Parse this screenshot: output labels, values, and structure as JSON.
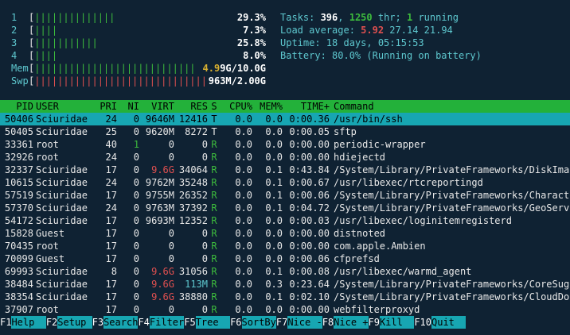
{
  "meters": {
    "cpu": [
      {
        "label": "1",
        "bars": "||||||||||||||",
        "value": "29.3%"
      },
      {
        "label": "2",
        "bars": "||||",
        "value": "7.3%"
      },
      {
        "label": "3",
        "bars": "|||||||||||",
        "value": "25.8%"
      },
      {
        "label": "4",
        "bars": "||||",
        "value": "8.0%"
      }
    ],
    "mem": {
      "label": "Mem",
      "bars": "||||||||||||||||||||||||||||",
      "value_num": "4.9",
      "value_rest": "9G/10.0G"
    },
    "swp": {
      "label": "Swp",
      "bars": "||||||||||||||||||||||||||||||",
      "value": "963M/2.00G"
    }
  },
  "info": {
    "tasks_label": "Tasks: ",
    "tasks": "396",
    "thr": "1250",
    "thr_label": " thr; ",
    "running": "1",
    "running_label": " running",
    "load_label": "Load average: ",
    "load1": "5.92",
    "load5": "27.14",
    "load15": "21.94",
    "uptime_label": "Uptime: ",
    "uptime": "18 days, 05:15:53",
    "battery_label": "Battery: ",
    "battery": "80.0% (Running on battery)"
  },
  "columns": {
    "pid": "PID",
    "user": "USER",
    "pri": "PRI",
    "ni": "NI",
    "virt": "VIRT",
    "res": "RES",
    "s": "S",
    "cpu": "CPU%",
    "mem": "MEM%",
    "time": "TIME+",
    "cmd": "Command"
  },
  "processes": [
    {
      "pid": "50406",
      "user": "Sciuridae",
      "pri": "24",
      "ni": "0",
      "virt": "9646M",
      "res": "12416",
      "s": "T",
      "cpu": "0.0",
      "mem": "0.0",
      "time": "0:00.36",
      "cmd": "/usr/bin/ssh"
    },
    {
      "pid": "50405",
      "user": "Sciuridae",
      "pri": "25",
      "ni": "0",
      "virt": "9620M",
      "res": "8272",
      "s": "T",
      "cpu": "0.0",
      "mem": "0.0",
      "time": "0:00.05",
      "cmd": "sftp"
    },
    {
      "pid": "33361",
      "user": "root",
      "pri": "40",
      "ni": "1",
      "virt": "0",
      "res": "0",
      "s": "R",
      "cpu": "0.0",
      "mem": "0.0",
      "time": "0:00.00",
      "cmd": "periodic-wrapper"
    },
    {
      "pid": "32926",
      "user": "root",
      "pri": "24",
      "ni": "0",
      "virt": "0",
      "res": "0",
      "s": "R",
      "cpu": "0.0",
      "mem": "0.0",
      "time": "0:00.00",
      "cmd": "hdiejectd"
    },
    {
      "pid": "32337",
      "user": "Sciuridae",
      "pri": "17",
      "ni": "0",
      "virt": "9.6G",
      "res": "34064",
      "s": "R",
      "cpu": "0.0",
      "mem": "0.1",
      "time": "0:43.84",
      "cmd": "/System/Library/PrivateFrameworks/DiskImages"
    },
    {
      "pid": "10615",
      "user": "Sciuridae",
      "pri": "24",
      "ni": "0",
      "virt": "9762M",
      "res": "35248",
      "s": "R",
      "cpu": "0.0",
      "mem": "0.1",
      "time": "0:00.67",
      "cmd": "/usr/libexec/rtcreportingd"
    },
    {
      "pid": "57519",
      "user": "Sciuridae",
      "pri": "17",
      "ni": "0",
      "virt": "9755M",
      "res": "26352",
      "s": "R",
      "cpu": "0.0",
      "mem": "0.1",
      "time": "0:00.06",
      "cmd": "/System/Library/PrivateFrameworks/CharacterP"
    },
    {
      "pid": "57370",
      "user": "Sciuridae",
      "pri": "24",
      "ni": "0",
      "virt": "9763M",
      "res": "37392",
      "s": "R",
      "cpu": "0.0",
      "mem": "0.1",
      "time": "0:04.72",
      "cmd": "/System/Library/PrivateFrameworks/GeoService"
    },
    {
      "pid": "54172",
      "user": "Sciuridae",
      "pri": "17",
      "ni": "0",
      "virt": "9693M",
      "res": "12352",
      "s": "R",
      "cpu": "0.0",
      "mem": "0.0",
      "time": "0:00.03",
      "cmd": "/usr/libexec/loginitemregisterd"
    },
    {
      "pid": "15828",
      "user": "Guest",
      "pri": "17",
      "ni": "0",
      "virt": "0",
      "res": "0",
      "s": "R",
      "cpu": "0.0",
      "mem": "0.0",
      "time": "0:00.00",
      "cmd": "distnoted"
    },
    {
      "pid": "70435",
      "user": "root",
      "pri": "17",
      "ni": "0",
      "virt": "0",
      "res": "0",
      "s": "R",
      "cpu": "0.0",
      "mem": "0.0",
      "time": "0:00.00",
      "cmd": "com.apple.Ambien"
    },
    {
      "pid": "70099",
      "user": "Guest",
      "pri": "17",
      "ni": "0",
      "virt": "0",
      "res": "0",
      "s": "R",
      "cpu": "0.0",
      "mem": "0.0",
      "time": "0:00.06",
      "cmd": "cfprefsd"
    },
    {
      "pid": "69993",
      "user": "Sciuridae",
      "pri": "8",
      "ni": "0",
      "virt": "9.6G",
      "res": "31056",
      "s": "R",
      "cpu": "0.0",
      "mem": "0.1",
      "time": "0:00.08",
      "cmd": "/usr/libexec/warmd_agent"
    },
    {
      "pid": "38484",
      "user": "Sciuridae",
      "pri": "17",
      "ni": "0",
      "virt": "9.6G",
      "res": "113M",
      "s": "R",
      "cpu": "0.0",
      "mem": "0.3",
      "time": "0:23.64",
      "cmd": "/System/Library/PrivateFrameworks/CoreSugges"
    },
    {
      "pid": "38354",
      "user": "Sciuridae",
      "pri": "17",
      "ni": "0",
      "virt": "9.6G",
      "res": "38880",
      "s": "R",
      "cpu": "0.0",
      "mem": "0.1",
      "time": "0:02.10",
      "cmd": "/System/Library/PrivateFrameworks/CloudDocsD"
    },
    {
      "pid": "37907",
      "user": "root",
      "pri": "17",
      "ni": "0",
      "virt": "0",
      "res": "0",
      "s": "R",
      "cpu": "0.0",
      "mem": "0.0",
      "time": "0:00.00",
      "cmd": "webfilterproxyd"
    }
  ],
  "footer": [
    {
      "key": "F1",
      "label": "Help  "
    },
    {
      "key": "F2",
      "label": "Setup "
    },
    {
      "key": "F3",
      "label": "Search"
    },
    {
      "key": "F4",
      "label": "Filter"
    },
    {
      "key": "F5",
      "label": "Tree  "
    },
    {
      "key": "F6",
      "label": "SortBy"
    },
    {
      "key": "F7",
      "label": "Nice -"
    },
    {
      "key": "F8",
      "label": "Nice +"
    },
    {
      "key": "F9",
      "label": "Kill  "
    },
    {
      "key": "F10",
      "label": "Quit  "
    }
  ],
  "colors": {
    "background": "#0f2233",
    "header": "#23b13a",
    "selection": "#17a6b2",
    "green": "#3dbb3d",
    "red": "#e05050",
    "cyan": "#5ec8cf"
  }
}
